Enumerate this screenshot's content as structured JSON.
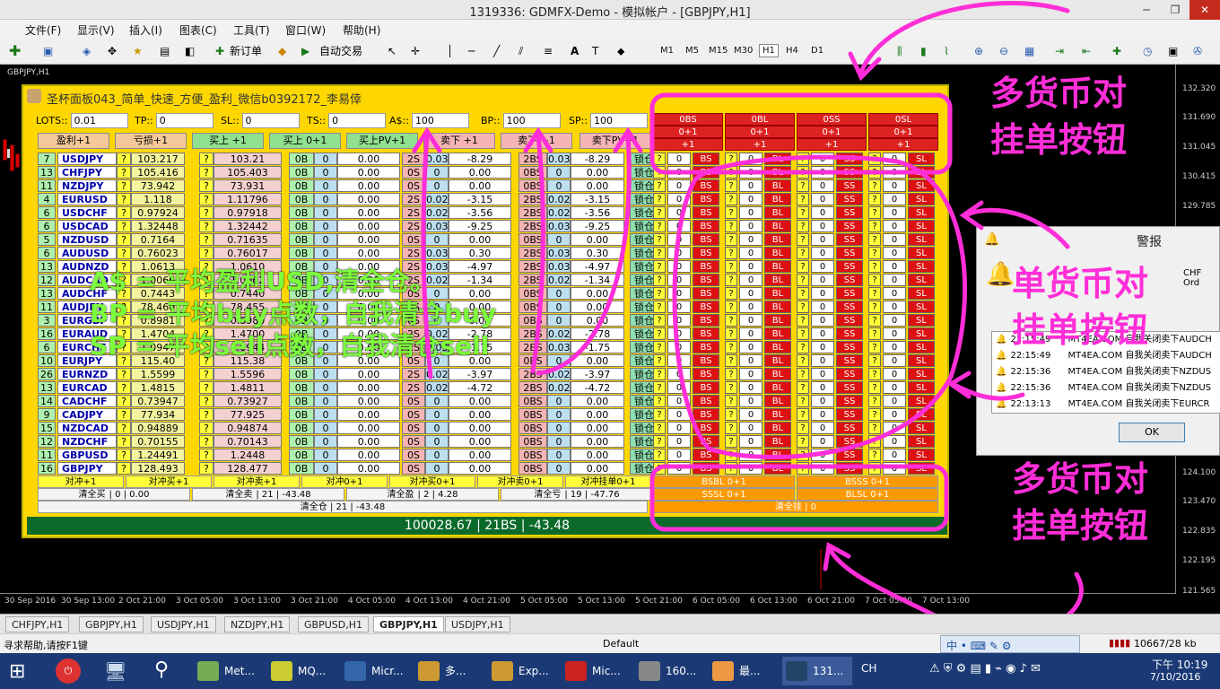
{
  "window": {
    "title": "1319336: GDMFX-Demo - 模拟帐户 - [GBPJPY,H1]"
  },
  "menu": [
    "文件(F)",
    "显示(V)",
    "插入(I)",
    "图表(C)",
    "工具(T)",
    "窗口(W)",
    "帮助(H)"
  ],
  "toolbar": {
    "new_order": "新订单",
    "auto_trade": "自动交易",
    "timeframes": [
      "M1",
      "M5",
      "M15",
      "M30",
      "H1",
      "H4",
      "D1"
    ]
  },
  "chart": {
    "symbol_label": "GBPJPY,H1",
    "prices": [
      "132.320",
      "131.690",
      "131.045",
      "130.415",
      "129.785",
      "124.100",
      "123.470",
      "122.835",
      "122.195",
      "121.565"
    ],
    "dates": [
      "30 Sep 2016",
      "30 Sep 13:00",
      "2 Oct 21:00",
      "3 Oct 05:00",
      "3 Oct 13:00",
      "3 Oct 21:00",
      "4 Oct 05:00",
      "4 Oct 13:00",
      "4 Oct 21:00",
      "5 Oct 05:00",
      "5 Oct 13:00",
      "5 Oct 21:00",
      "6 Oct 05:00",
      "6 Oct 13:00",
      "6 Oct 21:00",
      "7 Oct 05:00",
      "7 Oct 13:00"
    ]
  },
  "panel": {
    "title": "圣杯面板043_简单_快速_方便_盈利_微信b0392172_李易倖",
    "params": [
      {
        "label": "LOTS::",
        "value": "0.01"
      },
      {
        "label": "TP::",
        "value": "0"
      },
      {
        "label": "SL::",
        "value": "0"
      },
      {
        "label": "TS::",
        "value": "0"
      },
      {
        "label": "A$::",
        "value": "100"
      },
      {
        "label": "BP::",
        "value": "100"
      },
      {
        "label": "SP::",
        "value": "100"
      }
    ],
    "action_buttons": [
      "盈利+1",
      "亏损+1",
      "买上 +1",
      "买上 0+1",
      "买上PV+1",
      "卖下 +1",
      "卖下 +1",
      "卖下PV+1"
    ],
    "multi_header": [
      [
        "0BS",
        "0BL",
        "0SS",
        "0SL"
      ],
      [
        "0+1",
        "0+1",
        "0+1",
        "0+1"
      ],
      [
        "+1",
        "+1",
        "+1",
        "+1"
      ]
    ],
    "rows": [
      {
        "n": "7",
        "sym": "USDJPY",
        "bid": "103.217",
        "ask": "103.21",
        "b": "0B",
        "bq": "0",
        "bp": "0.00",
        "s": "2S",
        "sq": "0.03",
        "sp": "-8.29",
        "bs": "2BS",
        "bsq": "0.03",
        "bsp": "-8.29"
      },
      {
        "n": "13",
        "sym": "CHFJPY",
        "bid": "105.416",
        "ask": "105.403",
        "b": "0B",
        "bq": "0",
        "bp": "0.00",
        "s": "0S",
        "sq": "0",
        "sp": "0.00",
        "bs": "0BS",
        "bsq": "0",
        "bsp": "0.00"
      },
      {
        "n": "11",
        "sym": "NZDJPY",
        "bid": "73.942",
        "ask": "73.931",
        "b": "0B",
        "bq": "0",
        "bp": "0.00",
        "s": "0S",
        "sq": "0",
        "sp": "0.00",
        "bs": "0BS",
        "bsq": "0",
        "bsp": "0.00"
      },
      {
        "n": "4",
        "sym": "EURUSD",
        "bid": "1.118",
        "ask": "1.11796",
        "b": "0B",
        "bq": "0",
        "bp": "0.00",
        "s": "2S",
        "sq": "0.02",
        "sp": "-3.15",
        "bs": "2BS",
        "bsq": "0.02",
        "bsp": "-3.15"
      },
      {
        "n": "6",
        "sym": "USDCHF",
        "bid": "0.97924",
        "ask": "0.97918",
        "b": "0B",
        "bq": "0",
        "bp": "0.00",
        "s": "2S",
        "sq": "0.02",
        "sp": "-3.56",
        "bs": "2BS",
        "bsq": "0.02",
        "bsp": "-3.56"
      },
      {
        "n": "6",
        "sym": "USDCAD",
        "bid": "1.32448",
        "ask": "1.32442",
        "b": "0B",
        "bq": "0",
        "bp": "0.00",
        "s": "2S",
        "sq": "0.03",
        "sp": "-9.25",
        "bs": "2BS",
        "bsq": "0.03",
        "bsp": "-9.25"
      },
      {
        "n": "5",
        "sym": "NZDUSD",
        "bid": "0.7164",
        "ask": "0.71635",
        "b": "0B",
        "bq": "0",
        "bp": "0.00",
        "s": "0S",
        "sq": "0",
        "sp": "0.00",
        "bs": "0BS",
        "bsq": "0",
        "bsp": "0.00"
      },
      {
        "n": "6",
        "sym": "AUDUSD",
        "bid": "0.76023",
        "ask": "0.76017",
        "b": "0B",
        "bq": "0",
        "bp": "0.00",
        "s": "2S",
        "sq": "0.03",
        "sp": "0.30",
        "bs": "2BS",
        "bsq": "0.03",
        "bsp": "0.30"
      },
      {
        "n": "13",
        "sym": "AUDNZD",
        "bid": "1.0613",
        "ask": "1.0610",
        "b": "0B",
        "bq": "0",
        "bp": "0.00",
        "s": "2S",
        "sq": "0.03",
        "sp": "-4.97",
        "bs": "2BS",
        "bsq": "0.03",
        "bsp": "-4.97"
      },
      {
        "n": "12",
        "sym": "AUDCAD",
        "bid": "1.0066",
        "ask": "1.0062",
        "b": "0B",
        "bq": "0",
        "bp": "0.00",
        "s": "2S",
        "sq": "0.02",
        "sp": "-1.34",
        "bs": "2BS",
        "bsq": "0.02",
        "bsp": "-1.34"
      },
      {
        "n": "13",
        "sym": "AUDCHF",
        "bid": "0.7443",
        "ask": "0.7440",
        "b": "0B",
        "bq": "0",
        "bp": "0.00",
        "s": "0S",
        "sq": "0",
        "sp": "0.00",
        "bs": "0BS",
        "bsq": "0",
        "bsp": "0.00"
      },
      {
        "n": "11",
        "sym": "AUDJPY",
        "bid": "78.460",
        "ask": "78.455",
        "b": "0B",
        "bq": "0",
        "bp": "0.00",
        "s": "0S",
        "sq": "0",
        "sp": "0.00",
        "bs": "0BS",
        "bsq": "0",
        "bsp": "0.00"
      },
      {
        "n": "3",
        "sym": "EURGBP",
        "bid": "0.8981",
        "ask": "0.8980",
        "b": "0B",
        "bq": "0",
        "bp": "0.00",
        "s": "0S",
        "sq": "0",
        "sp": "0.00",
        "bs": "0BS",
        "bsq": "0",
        "bsp": "0.00"
      },
      {
        "n": "16",
        "sym": "EURAUD",
        "bid": "1.4704",
        "ask": "1.4700",
        "b": "0B",
        "bq": "0",
        "bp": "0.00",
        "s": "2S",
        "sq": "0.02",
        "sp": "-2.78",
        "bs": "2BS",
        "bsq": "0.02",
        "bsp": "-2.78"
      },
      {
        "n": "6",
        "sym": "EURCHF",
        "bid": "1.0947",
        "ask": "1.0944",
        "b": "0B",
        "bq": "0",
        "bp": "0.00",
        "s": "2S",
        "sq": "0.03",
        "sp": "-1.75",
        "bs": "2BS",
        "bsq": "0.03",
        "bsp": "-1.75"
      },
      {
        "n": "10",
        "sym": "EURJPY",
        "bid": "115.40",
        "ask": "115.38",
        "b": "0B",
        "bq": "0",
        "bp": "0.00",
        "s": "0S",
        "sq": "0",
        "sp": "0.00",
        "bs": "0BS",
        "bsq": "0",
        "bsp": "0.00"
      },
      {
        "n": "26",
        "sym": "EURNZD",
        "bid": "1.5599",
        "ask": "1.5596",
        "b": "0B",
        "bq": "0",
        "bp": "0.00",
        "s": "2S",
        "sq": "0.02",
        "sp": "-3.97",
        "bs": "2BS",
        "bsq": "0.02",
        "bsp": "-3.97"
      },
      {
        "n": "13",
        "sym": "EURCAD",
        "bid": "1.4815",
        "ask": "1.4811",
        "b": "0B",
        "bq": "0",
        "bp": "0.00",
        "s": "2S",
        "sq": "0.02",
        "sp": "-4.72",
        "bs": "2BS",
        "bsq": "0.02",
        "bsp": "-4.72"
      },
      {
        "n": "14",
        "sym": "CADCHF",
        "bid": "0.73947",
        "ask": "0.73927",
        "b": "0B",
        "bq": "0",
        "bp": "0.00",
        "s": "0S",
        "sq": "0",
        "sp": "0.00",
        "bs": "0BS",
        "bsq": "0",
        "bsp": "0.00"
      },
      {
        "n": "9",
        "sym": "CADJPY",
        "bid": "77.934",
        "ask": "77.925",
        "b": "0B",
        "bq": "0",
        "bp": "0.00",
        "s": "0S",
        "sq": "0",
        "sp": "0.00",
        "bs": "0BS",
        "bsq": "0",
        "bsp": "0.00"
      },
      {
        "n": "15",
        "sym": "NZDCAD",
        "bid": "0.94889",
        "ask": "0.94874",
        "b": "0B",
        "bq": "0",
        "bp": "0.00",
        "s": "0S",
        "sq": "0",
        "sp": "0.00",
        "bs": "0BS",
        "bsq": "0",
        "bsp": "0.00"
      },
      {
        "n": "12",
        "sym": "NZDCHF",
        "bid": "0.70155",
        "ask": "0.70143",
        "b": "0B",
        "bq": "0",
        "bp": "0.00",
        "s": "0S",
        "sq": "0",
        "sp": "0.00",
        "bs": "0BS",
        "bsq": "0",
        "bsp": "0.00"
      },
      {
        "n": "11",
        "sym": "GBPUSD",
        "bid": "1.24491",
        "ask": "1.2448",
        "b": "0B",
        "bq": "0",
        "bp": "0.00",
        "s": "0S",
        "sq": "0",
        "sp": "0.00",
        "bs": "0BS",
        "bsq": "0",
        "bsp": "0.00"
      },
      {
        "n": "16",
        "sym": "GBPJPY",
        "bid": "128.493",
        "ask": "128.477",
        "b": "0B",
        "bq": "0",
        "bp": "0.00",
        "s": "0S",
        "sq": "0",
        "sp": "0.00",
        "bs": "0BS",
        "bsq": "0",
        "bsp": "0.00"
      }
    ],
    "row_lock": "锁仓",
    "row_q": "?",
    "row_right": {
      "zero": "0",
      "bs": "BS",
      "bl": "BL",
      "ss": "SS",
      "sl": "SL"
    },
    "hedge_buttons": [
      "对冲+1",
      "对冲买+1",
      "对冲卖+1",
      "对冲0+1",
      "对冲买0+1",
      "对冲卖0+1",
      "对冲挂单0+1"
    ],
    "multi_bottom": {
      "bsbl": "BSBL 0+1",
      "bsss": "BSSS 0+1",
      "sssl": "SSSL 0+1",
      "blsl": "BLSL 0+1",
      "clear_pending": "清全挂 | 0"
    },
    "close_row": [
      {
        "label": "清全买",
        "info": "| 0 | 0.00"
      },
      {
        "label": "清全卖",
        "info": "| 21 | -43.48"
      },
      {
        "label": "清全盈",
        "info": "| 2 | 4.28"
      },
      {
        "label": "清全亏",
        "info": "| 19 | -47.76"
      }
    ],
    "close_all": "清全仓 | 21 | -43.48",
    "footer": "100028.67 | 21BS | -43.48"
  },
  "overlay": [
    "A$ = 平均盈利USD,清全仓。",
    "BP = 平均buy点数，自我清仓buy",
    "SP = 平均sell点数，自我清仓sell"
  ],
  "annotations": {
    "multi_top": [
      "多货币对",
      "挂单按钮"
    ],
    "single": [
      "单货币对",
      "挂单按钮"
    ],
    "multi_bottom": [
      "多货币对",
      "挂单按钮"
    ]
  },
  "alert": {
    "title": "警报",
    "partial": "CHF Ord",
    "items": [
      {
        "time": "22:15:49",
        "text": "MT4EA.COM 自我关闭卖下AUDCH"
      },
      {
        "time": "22:15:49",
        "text": "MT4EA.COM 自我关闭卖下AUDCH"
      },
      {
        "time": "22:15:36",
        "text": "MT4EA.COM 自我关闭卖下NZDUS"
      },
      {
        "time": "22:15:36",
        "text": "MT4EA.COM 自我关闭卖下NZDUS"
      },
      {
        "time": "22:13:13",
        "text": "MT4EA.COM 自我关闭卖下EURCR"
      }
    ],
    "ok": "OK"
  },
  "tabs": [
    "CHFJPY,H1",
    "GBPJPY,H1",
    "USDJPY,H1",
    "NZDJPY,H1",
    "GBPUSD,H1",
    "GBPJPY,H1",
    "USDJPY,H1"
  ],
  "active_tab": 5,
  "status": {
    "help": "寻求帮助,请按F1键",
    "profile": "Default",
    "traffic": "10667/28 kb"
  },
  "taskbar": {
    "items": [
      "Met...",
      "MQ...",
      "Micr...",
      "多...",
      "Exp...",
      "Mic...",
      "160...",
      "最...",
      "131..."
    ],
    "lang": "CH",
    "time": "下午 10:19",
    "date": "7/10/2016"
  },
  "colors": {
    "panel": "#ffd700",
    "red_btn": "#dd1111",
    "green_btn": "#8fe08f",
    "pink_cell": "#f4b4b4",
    "annotation": "#ff2ed8",
    "overlay_text": "#7cff3c"
  }
}
